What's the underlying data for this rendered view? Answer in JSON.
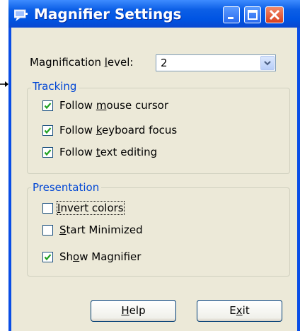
{
  "window": {
    "title": "Magnifier Settings",
    "accent_color": "#0054e3",
    "client_color": "#ece9d8",
    "title_icon": "magnifier-app-icon",
    "controls": [
      "minimize-icon",
      "maximize-icon",
      "close-icon"
    ]
  },
  "magnification": {
    "label_pre": "Magnification ",
    "label_key": "l",
    "label_post": "evel:",
    "value": "2"
  },
  "tracking": {
    "legend": "Tracking",
    "items": [
      {
        "pre": "Follow ",
        "key": "m",
        "post": "ouse cursor",
        "checked": true
      },
      {
        "pre": "Follow ",
        "key": "k",
        "post": "eyboard focus",
        "checked": true
      },
      {
        "pre": "Follow ",
        "key": "t",
        "post": "ext editing",
        "checked": true
      }
    ]
  },
  "presentation": {
    "legend": "Presentation",
    "items": [
      {
        "pre": "",
        "key": "I",
        "post": "nvert colors",
        "checked": false
      },
      {
        "pre": "",
        "key": "S",
        "post": "tart Minimized",
        "checked": false
      },
      {
        "pre": "Sh",
        "key": "o",
        "post": "w Magnifier",
        "checked": true
      }
    ]
  },
  "buttons": {
    "help": {
      "pre": "",
      "key": "H",
      "post": "elp"
    },
    "exit": {
      "pre": "E",
      "key": "x",
      "post": "it"
    }
  }
}
